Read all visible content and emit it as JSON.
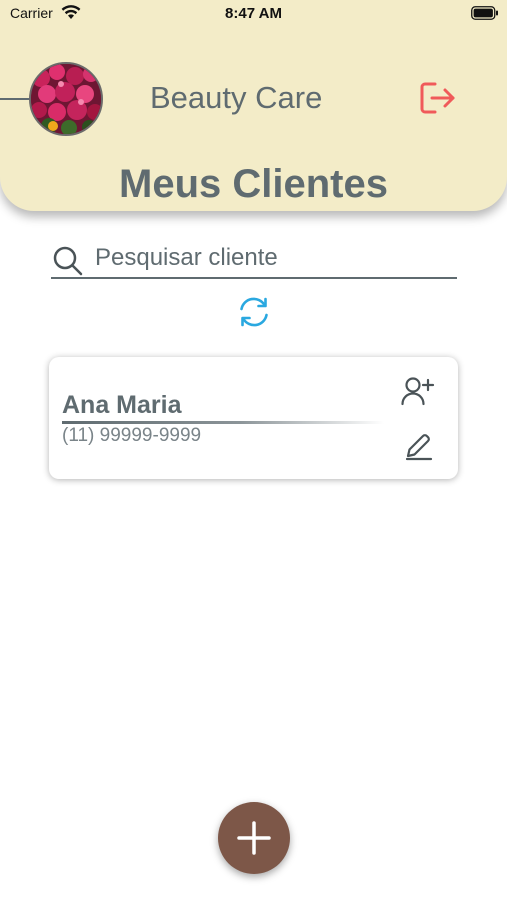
{
  "status_bar": {
    "carrier": "Carrier",
    "time": "8:47 AM"
  },
  "header": {
    "app_title": "Beauty Care",
    "page_title": "Meus Clientes",
    "logout_icon": "logout-icon",
    "avatar": "flowers-photo"
  },
  "search": {
    "placeholder": "Pesquisar cliente",
    "value": ""
  },
  "clients": [
    {
      "name": "Ana Maria",
      "phone": "(11) 99999-9999"
    }
  ],
  "icons": {
    "search": "search-icon",
    "refresh": "refresh-icon",
    "add_user": "add-user-icon",
    "edit": "edit-icon",
    "add": "plus-icon"
  },
  "colors": {
    "header_bg": "#f3ecc8",
    "text_primary": "#5f6b70",
    "logout_accent": "#f05a5a",
    "refresh_accent": "#2aa8e0",
    "fab_bg": "#7d5748"
  }
}
